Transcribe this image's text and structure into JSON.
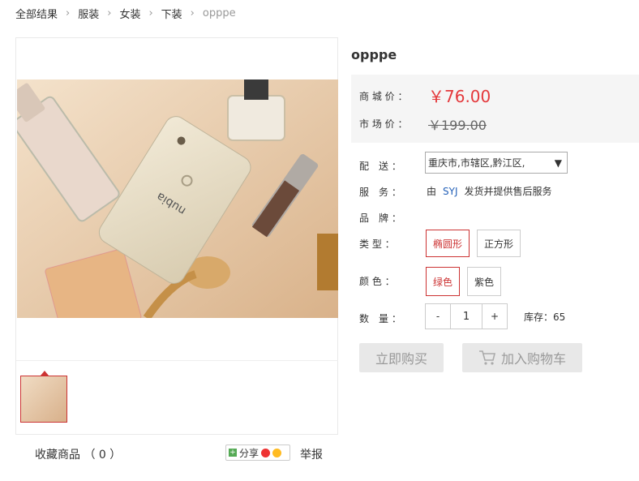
{
  "breadcrumb": {
    "items": [
      "全部结果",
      "服装",
      "女装",
      "下装"
    ],
    "current": "opppe",
    "separator": ">"
  },
  "product": {
    "title": "opppe"
  },
  "prices": {
    "mall_label": "商 城 价 ：",
    "mall_price": "￥76.00",
    "market_label": "市 场 价 ：",
    "market_price": "￥199.00"
  },
  "delivery": {
    "label": "配　送 ：",
    "value": "重庆市,市辖区,黔江区,"
  },
  "service": {
    "label": "服　务 ：",
    "prefix": "由",
    "seller": "SYJ",
    "suffix": "发货并提供售后服务"
  },
  "brand": {
    "label": "品　牌 ："
  },
  "type": {
    "label": "类 型 ：",
    "options": [
      "椭圆形",
      "正方形"
    ],
    "selected": "椭圆形"
  },
  "color": {
    "label": "颜 色 ：",
    "options": [
      "绿色",
      "紫色"
    ],
    "selected": "绿色"
  },
  "quantity": {
    "label": "数　量 ：",
    "minus": "-",
    "value": "1",
    "plus": "+",
    "stock": "库存：65"
  },
  "actions": {
    "buy_now": "立即购买",
    "add_cart": "加入购物车"
  },
  "gallery": {
    "favorite": "收藏商品 （ 0 ）",
    "share": "分享",
    "report": "举报"
  },
  "colors": {
    "accent": "#e4393c",
    "selected_border": "#cc3333",
    "link": "#2461b8"
  }
}
